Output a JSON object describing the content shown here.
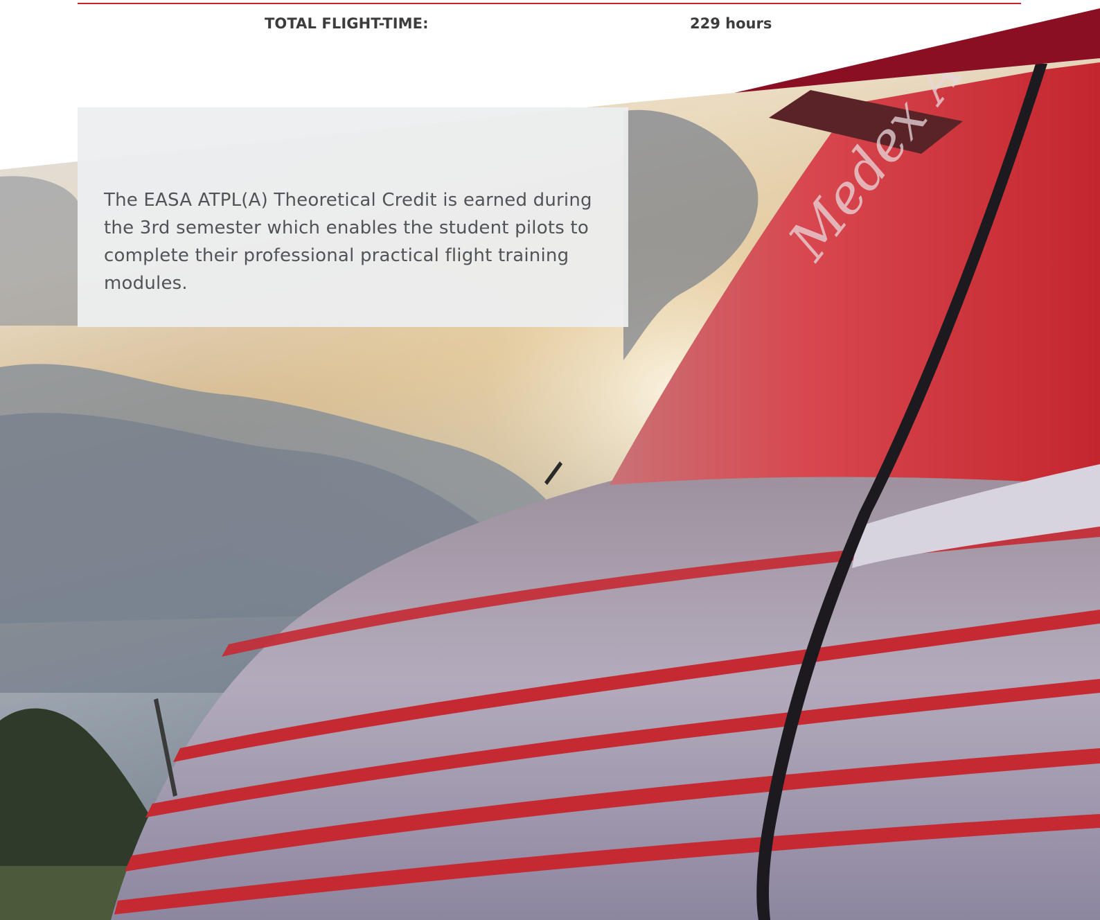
{
  "stats": {
    "total_flight_time_label": "TOTAL FLIGHT-TIME:",
    "total_flight_time_value": "229 hours"
  },
  "intro": {
    "text": "The EASA ATPL(A) Theoretical Credit is earned during the 3rd semester which enables the student pilots to complete their professional practical flight training modules."
  },
  "hero": {
    "aircraft_livery_text": "Medex Air"
  },
  "colors": {
    "brand_red": "#c8202a",
    "brand_dark_red": "#8a0f22",
    "text_dark": "#3c3c3c",
    "text_body": "#505358",
    "card_bg": "#eceef0"
  }
}
